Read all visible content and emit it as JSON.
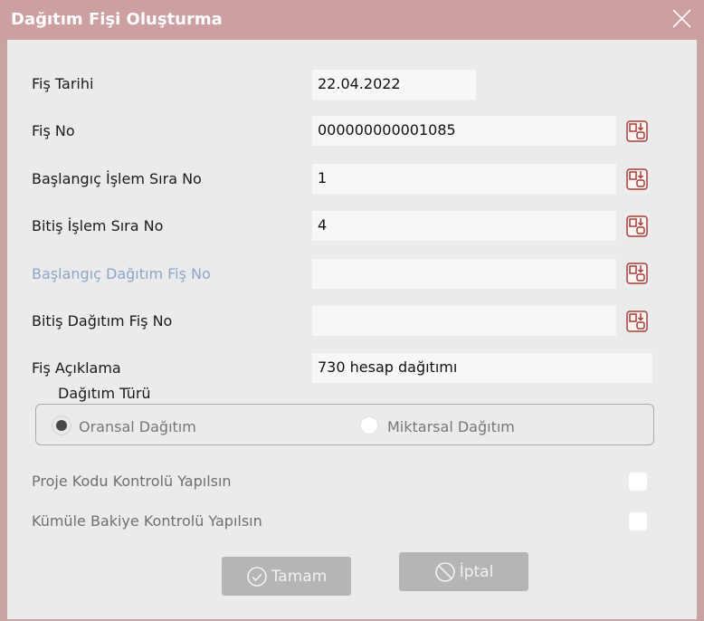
{
  "window": {
    "title": "Dağıtım Fişi Oluşturma"
  },
  "fields": [
    {
      "label": "Fiş Tarihi",
      "value": "22.04.2022"
    },
    {
      "label": "Fiş No",
      "value": "000000000001085"
    },
    {
      "label": "Başlangıç İşlem Sıra No",
      "value": "1"
    },
    {
      "label": "Bitiş İşlem Sıra No",
      "value": "4"
    },
    {
      "label": "Başlangıç Dağıtım Fiş No",
      "value": ""
    },
    {
      "label": "Bitiş Dağıtım Fiş No",
      "value": ""
    },
    {
      "label": "Fiş Açıklama",
      "value": "730 hesap dağıtımı"
    }
  ],
  "distribution": {
    "group_title": "Dağıtım Türü",
    "options": [
      {
        "label": "Oransal Dağıtım",
        "selected": true
      },
      {
        "label": "Miktarsal Dağıtım",
        "selected": false
      }
    ]
  },
  "checks": [
    {
      "label": "Proje Kodu Kontrolü Yapılsın",
      "checked": false
    },
    {
      "label": "Kümüle Bakiye Kontrolü Yapılsın",
      "checked": false
    }
  ],
  "buttons": {
    "ok": "Tamam",
    "cancel": "İptal"
  },
  "colors": {
    "title_bar": "#cc9fa0",
    "lookup_icon": "#b04a4a",
    "disabled_label": "#8fa6c9"
  }
}
